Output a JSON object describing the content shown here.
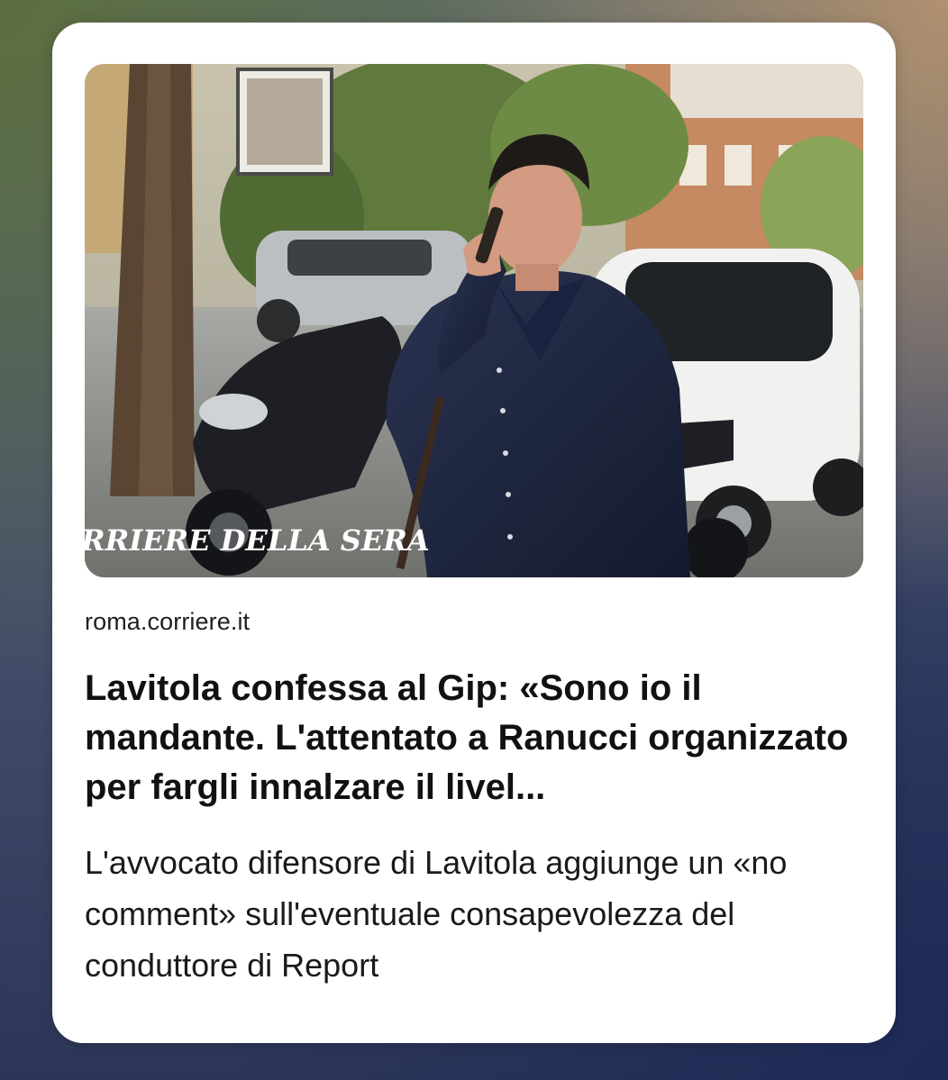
{
  "article": {
    "image": {
      "subject": "man-on-phone-street-photo",
      "watermark": "RRIERE DELLA SERA"
    },
    "source": "roma.corriere.it",
    "headline": "Lavitola confessa al Gip: «Sono io il mandante. L'attentato a Ranucci organizzato per fargli innalzare il livel...",
    "summary": "L'avvocato difensore di Lavitola aggiunge un «no comment» sull'eventuale consapevolezza del conduttore di Report"
  },
  "colors": {
    "card_background": "#ffffff",
    "text_primary": "#111111",
    "text_source": "#1f1f1f"
  }
}
